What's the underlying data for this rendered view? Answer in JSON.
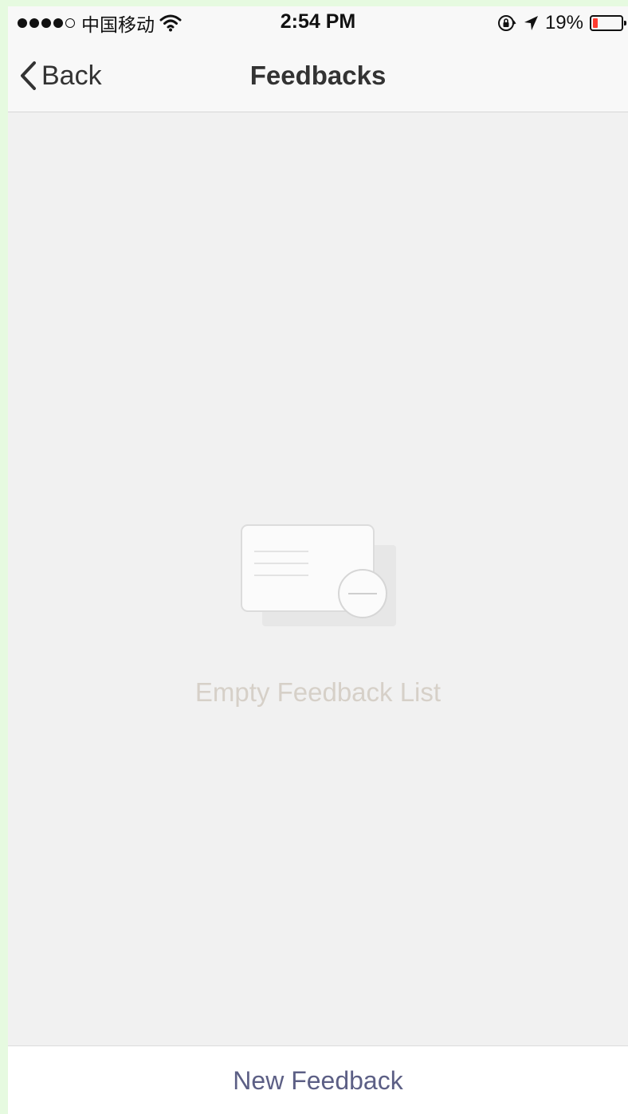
{
  "status_bar": {
    "carrier": "中国移动",
    "time": "2:54 PM",
    "battery_percent": "19%",
    "battery_level": 0.19,
    "signal_bars": 4,
    "signal_max": 5,
    "battery_fill_color": "#ff3b30"
  },
  "nav": {
    "back_label": "Back",
    "title": "Feedbacks"
  },
  "empty_state": {
    "message": "Empty Feedback List",
    "icon": "empty-feedback-card-icon"
  },
  "footer": {
    "new_feedback_label": "New Feedback",
    "accent_color": "#5c5f85"
  }
}
